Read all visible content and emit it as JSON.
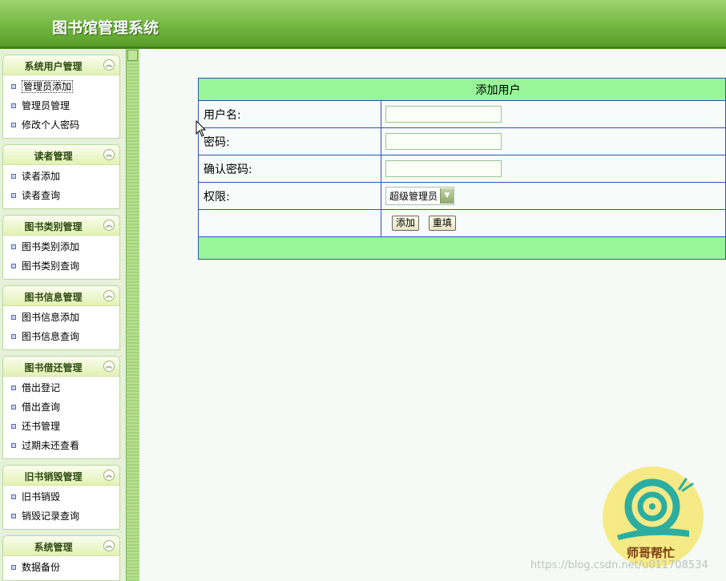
{
  "header": {
    "title": "图书馆管理系统"
  },
  "sidebar": {
    "groups": [
      {
        "title": "系统用户管理",
        "items": [
          "管理员添加",
          "管理员管理",
          "修改个人密码"
        ]
      },
      {
        "title": "读者管理",
        "items": [
          "读者添加",
          "读者查询"
        ]
      },
      {
        "title": "图书类别管理",
        "items": [
          "图书类别添加",
          "图书类别查询"
        ]
      },
      {
        "title": "图书信息管理",
        "items": [
          "图书信息添加",
          "图书信息查询"
        ]
      },
      {
        "title": "图书借还管理",
        "items": [
          "借出登记",
          "借出查询",
          "还书管理",
          "过期未还查看"
        ]
      },
      {
        "title": "旧书销毁管理",
        "items": [
          "旧书销毁",
          "销毁记录查询"
        ]
      },
      {
        "title": "系统管理",
        "items": [
          "数据备份"
        ]
      }
    ],
    "toggle_icon": "chevron-up-icon"
  },
  "form": {
    "heading": "添加用户",
    "username_label": "用户名:",
    "username_value": "",
    "password_label": "密码:",
    "password_value": "",
    "confirm_label": "确认密码:",
    "confirm_value": "",
    "role_label": "权限:",
    "role_selected": "超级管理员",
    "add_button": "添加",
    "reset_button": "重填"
  },
  "watermark": {
    "caption": "师哥帮忙",
    "url": "https://blog.csdn.net/u011708534"
  },
  "colors": {
    "header_green": "#74b842",
    "table_head_green": "#98f598",
    "table_border_blue": "#2b55b5"
  }
}
